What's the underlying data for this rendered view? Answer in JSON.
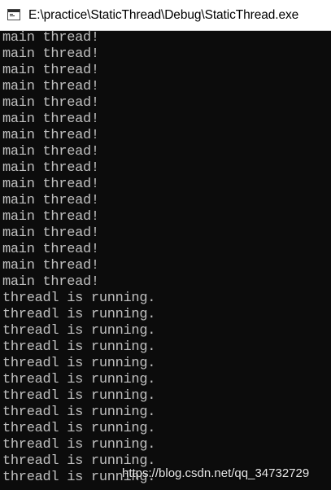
{
  "window": {
    "title": "E:\\practice\\StaticThread\\Debug\\StaticThread.exe",
    "icon": "console-window-icon"
  },
  "console": {
    "lines": [
      "main thread!",
      "main thread!",
      "main thread!",
      "main thread!",
      "main thread!",
      "main thread!",
      "main thread!",
      "main thread!",
      "main thread!",
      "main thread!",
      "main thread!",
      "main thread!",
      "main thread!",
      "main thread!",
      "main thread!",
      "main thread!",
      "threadl is running.",
      "threadl is running.",
      "threadl is running.",
      "threadl is running.",
      "threadl is running.",
      "threadl is running.",
      "threadl is running.",
      "threadl is running.",
      "threadl is running.",
      "threadl is running.",
      "threadl is running.",
      "threadl is running."
    ]
  },
  "watermark": "https://blog.csdn.net/qq_34732729",
  "colors": {
    "console_background": "#0c0c0c",
    "console_text": "#c0c0c0",
    "titlebar_background": "#ffffff"
  }
}
